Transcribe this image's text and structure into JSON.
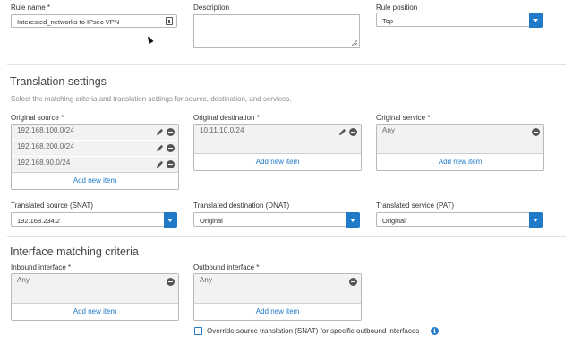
{
  "rule_name": {
    "label": "Rule name *",
    "value": "Interested_networks to IPsec VPN"
  },
  "description": {
    "label": "Description",
    "value": ""
  },
  "rule_position": {
    "label": "Rule position",
    "value": "Top"
  },
  "translation": {
    "title": "Translation settings",
    "subtitle": "Select the matching criteria and translation settings for source, destination, and services.",
    "original_source": {
      "label": "Original source *",
      "items": [
        "192.168.100.0/24",
        "192.168.200.0/24",
        "192.168.90.0/24"
      ],
      "add_label": "Add new item"
    },
    "original_destination": {
      "label": "Original destination *",
      "items": [
        "10.11.10.0/24"
      ],
      "add_label": "Add new item"
    },
    "original_service": {
      "label": "Original service *",
      "items": [
        "Any"
      ],
      "add_label": "Add new item"
    },
    "translated_source": {
      "label": "Translated source (SNAT)",
      "value": "192.168.234.2"
    },
    "translated_destination": {
      "label": "Translated destination (DNAT)",
      "value": "Original"
    },
    "translated_service": {
      "label": "Translated service (PAT)",
      "value": "Original"
    }
  },
  "interface": {
    "title": "Interface matching criteria",
    "inbound": {
      "label": "Inbound interface *",
      "items": [
        "Any"
      ],
      "add_label": "Add new item"
    },
    "outbound": {
      "label": "Outbound interface *",
      "items": [
        "Any"
      ],
      "add_label": "Add new item"
    },
    "override_label": "Override source translation (SNAT) for specific outbound interfaces",
    "override_checked": false
  },
  "colors": {
    "accent": "#1f7ac8"
  },
  "icons": [
    "clipboard-icon",
    "edit-icon",
    "remove-icon",
    "chevron-down-icon",
    "info-icon",
    "mouse-cursor-icon"
  ]
}
